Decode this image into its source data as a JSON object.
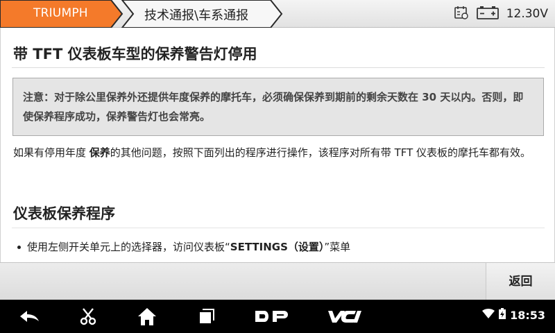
{
  "header": {
    "brand": "TRIUMPH",
    "path": "技术通报\\车系通报",
    "voltage": "12.30V",
    "brand_color": "#f47a2a"
  },
  "content": {
    "title": "带 TFT 仪表板车型的保养警告灯停用",
    "note": "注意：对于除公里保养外还提供年度保养的摩托车，必须确保保养到期前的剩余天数在 30 天以内。否则，即使保养程序成功，保养警告灯也会常亮。",
    "para_pre": "如果有停用年度 ",
    "para_bold": "保养",
    "para_post": "的其他问题，按照下面列出的程序进行操作，该程序对所有带 TFT 仪表板的摩托车都有效。",
    "section_title": "仪表板保养程序",
    "bullet_pre": "使用左侧开关单元上的选择器，访问仪表板“",
    "bullet_bold": "SETTINGS（设置）",
    "bullet_post": "”菜单"
  },
  "footer": {
    "back_label": "返回"
  },
  "system": {
    "time": "18:53"
  }
}
